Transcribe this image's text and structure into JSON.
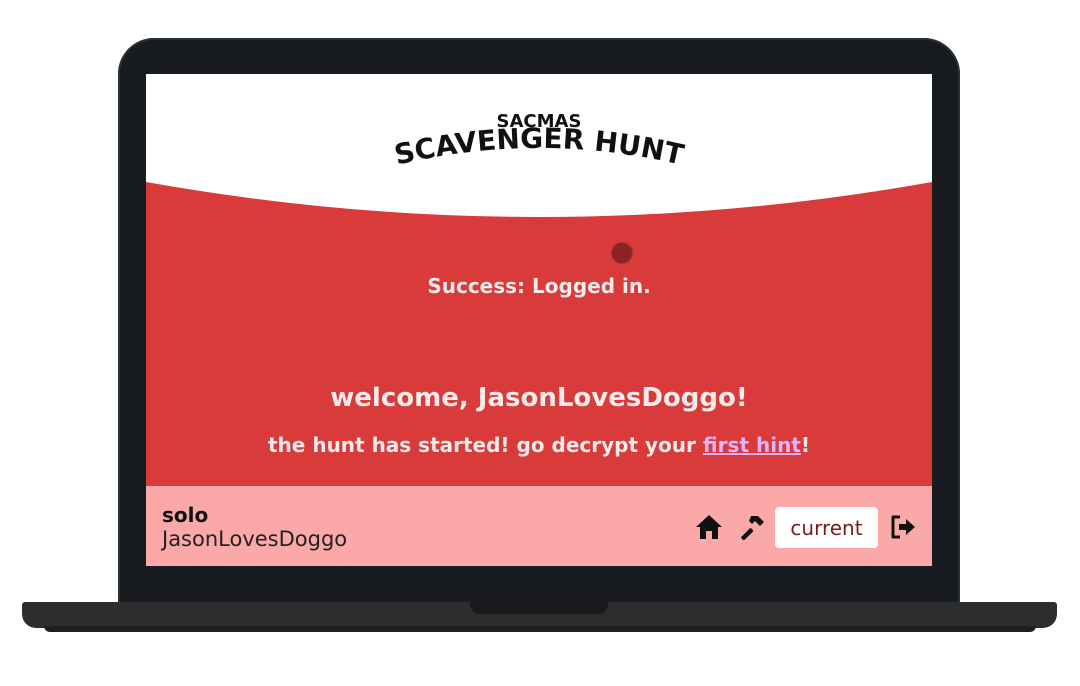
{
  "header": {
    "title_small": "SACMAS",
    "title_large": "SCAVENGER HUNT"
  },
  "toast": {
    "message": "Success: Logged in."
  },
  "main": {
    "welcome": "welcome, JasonLovesDoggo!",
    "hint_prefix": "the hunt has started! go decrypt your ",
    "hint_link": "first hint",
    "hint_suffix": "!"
  },
  "footer": {
    "mode": "solo",
    "username": "JasonLovesDoggo",
    "current_label": "current",
    "icons": [
      "home-icon",
      "hammer-icon",
      "logout-icon"
    ]
  },
  "colors": {
    "accent_red": "#d93a3a",
    "footer_pink": "#fba8a8",
    "link": "#e3b3ff"
  }
}
